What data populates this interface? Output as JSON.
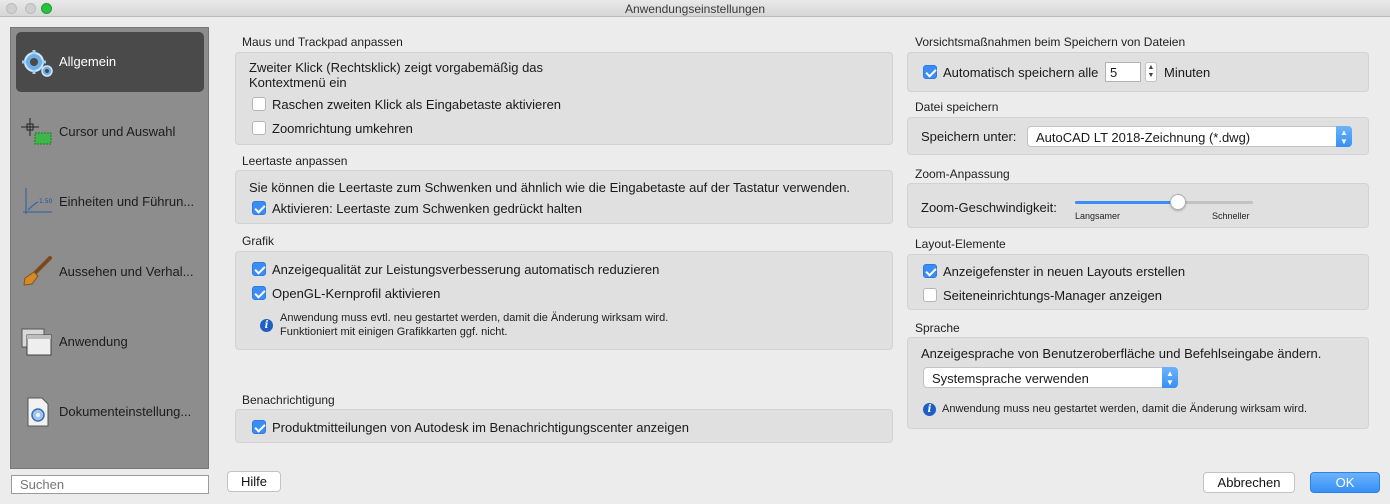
{
  "window": {
    "title": "Anwendungseinstellungen"
  },
  "sidebar": {
    "items": [
      {
        "label": "Allgemein",
        "icon": "gears-icon",
        "active": true
      },
      {
        "label": "Cursor und Auswahl",
        "icon": "cursor-selection-icon",
        "active": false
      },
      {
        "label": "Einheiten und Führun...",
        "icon": "units-guides-icon",
        "active": false
      },
      {
        "label": "Aussehen und Verhal...",
        "icon": "brush-icon",
        "active": false
      },
      {
        "label": "Anwendung",
        "icon": "windows-icon",
        "active": false
      },
      {
        "label": "Dokumenteinstellung...",
        "icon": "document-settings-icon",
        "active": false
      }
    ],
    "search_placeholder": "Suchen"
  },
  "left": {
    "mouse": {
      "title": "Maus und Trackpad anpassen",
      "info_line1": "Zweiter Klick (Rechtsklick) zeigt vorgabemäßig das",
      "info_line2": "Kontextmenü ein",
      "options": [
        {
          "label": "Raschen zweiten Klick als Eingabetaste aktivieren",
          "checked": false
        },
        {
          "label": "Zoomrichtung umkehren",
          "checked": false
        }
      ]
    },
    "space": {
      "title": "Leertaste anpassen",
      "description": "Sie können die Leertaste zum Schwenken und ähnlich wie die Eingabetaste auf der Tastatur verwenden.",
      "option": {
        "label": "Aktivieren: Leertaste zum Schwenken gedrückt halten",
        "checked": true
      }
    },
    "graphics": {
      "title": "Grafik",
      "options": [
        {
          "label": "Anzeigequalität zur Leistungsverbesserung automatisch reduzieren",
          "checked": true
        },
        {
          "label": "OpenGL-Kernprofil aktivieren",
          "checked": true
        }
      ],
      "note_line1": "Anwendung muss evtl. neu gestartet werden, damit die Änderung wirksam wird.",
      "note_line2": "Funktioniert mit einigen Grafikkarten ggf. nicht."
    },
    "notify": {
      "title": "Benachrichtigung",
      "option": {
        "label": "Produktmitteilungen von Autodesk im Benachrichtigungscenter anzeigen",
        "checked": true
      }
    }
  },
  "right": {
    "autosave": {
      "title": "Vorsichtsmaßnahmen beim Speichern von Dateien",
      "label": "Automatisch speichern alle",
      "value": "5",
      "unit": "Minuten",
      "checked": true
    },
    "filesave": {
      "title": "Datei speichern",
      "label": "Speichern unter:",
      "value": "AutoCAD LT 2018-Zeichnung (*.dwg)"
    },
    "zoom": {
      "title": "Zoom-Anpassung",
      "label": "Zoom-Geschwindigkeit:",
      "min_label": "Langsamer",
      "max_label": "Schneller",
      "level": 0.58
    },
    "layout": {
      "title": "Layout-Elemente",
      "options": [
        {
          "label": "Anzeigefenster in neuen Layouts erstellen",
          "checked": true
        },
        {
          "label": "Seiteneinrichtungs-Manager anzeigen",
          "checked": false
        }
      ]
    },
    "language": {
      "title": "Sprache",
      "description": "Anzeigesprache von Benutzeroberfläche und Befehlseingabe ändern.",
      "value": "Systemsprache verwenden",
      "note": "Anwendung muss neu gestartet werden, damit die Änderung wirksam wird."
    }
  },
  "buttons": {
    "help": "Hilfe",
    "cancel": "Abbrechen",
    "ok": "OK"
  },
  "colors": {
    "accent": "#3b8df5",
    "sidebar": "#8d8d8d",
    "sidebar_active": "#4a4a4a"
  }
}
